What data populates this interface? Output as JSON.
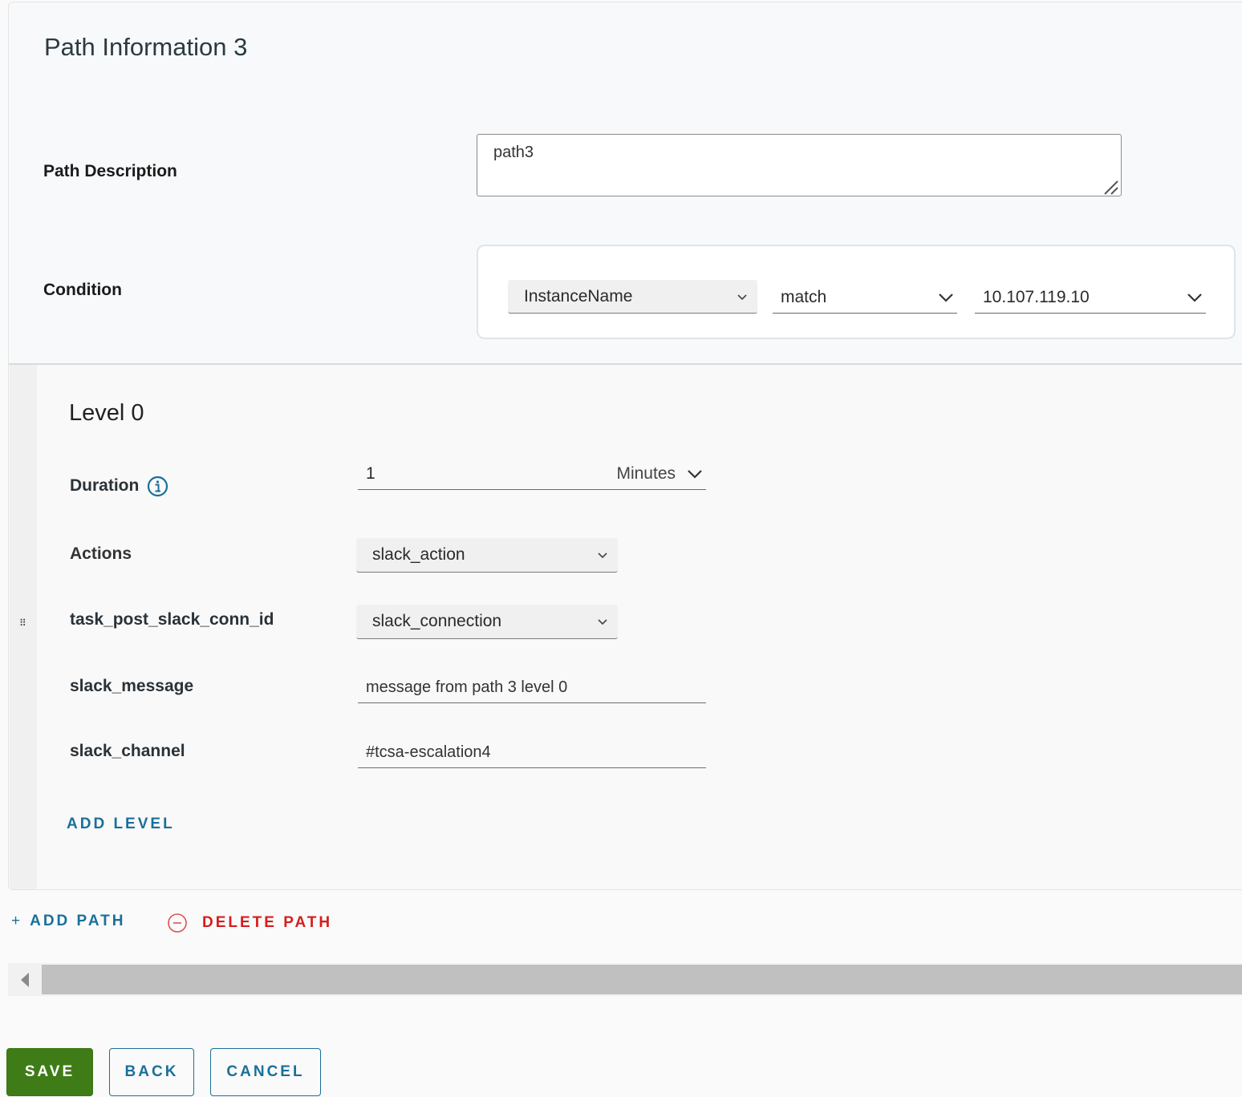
{
  "path": {
    "title": "Path Information 3",
    "description_label": "Path Description",
    "description_value": "path3",
    "condition_label": "Condition",
    "condition": {
      "field": "InstanceName",
      "operator": "match",
      "value": "10.107.119.10"
    }
  },
  "level": {
    "title": "Level 0",
    "duration_label": "Duration",
    "duration_value": "1",
    "duration_unit": "Minutes",
    "actions_label": "Actions",
    "actions_value": "slack_action",
    "conn_label": "task_post_slack_conn_id",
    "conn_value": "slack_connection",
    "message_label": "slack_message",
    "message_value": "message from path 3 level 0",
    "channel_label": "slack_channel",
    "channel_value": "#tcsa-escalation4",
    "add_level_label": "ADD LEVEL"
  },
  "path_actions": {
    "add_path_icon": "+",
    "add_path_label": "ADD PATH",
    "delete_path_label": "DELETE PATH"
  },
  "footer": {
    "save_label": "SAVE",
    "back_label": "BACK",
    "cancel_label": "CANCEL"
  },
  "colors": {
    "accent": "#1a6f99",
    "danger": "#d61d1d",
    "primary": "#3f7c17"
  }
}
